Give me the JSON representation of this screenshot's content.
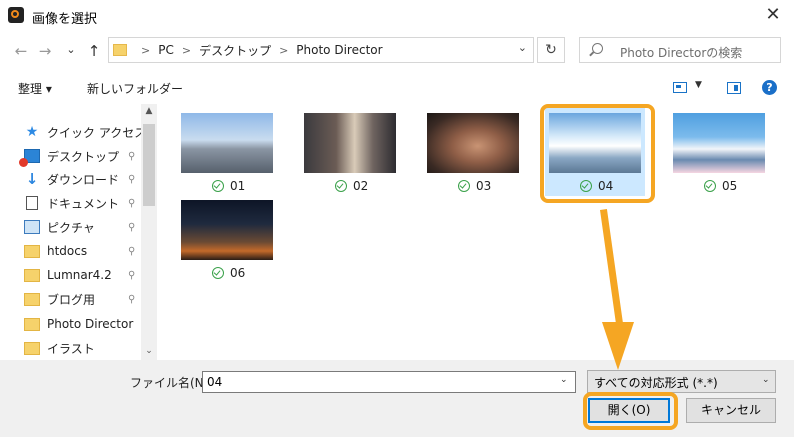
{
  "window": {
    "title": "画像を選択",
    "close_label": "✕"
  },
  "nav": {
    "back": "←",
    "forward": "→",
    "recent": "⌄",
    "up": "↑",
    "breadcrumb": [
      "PC",
      "デスクトップ",
      "Photo Director"
    ],
    "refresh": "↻",
    "search_placeholder": "Photo Directorの検索"
  },
  "toolbar": {
    "organize": "整理 ▾",
    "new_folder": "新しいフォルダー",
    "help": "?"
  },
  "sidebar": {
    "items": [
      {
        "label": "クイック アクセス",
        "icon": "star-icon",
        "pinned": false
      },
      {
        "label": "デスクトップ",
        "icon": "desktop-icon",
        "pinned": true
      },
      {
        "label": "ダウンロード",
        "icon": "download-icon",
        "pinned": true
      },
      {
        "label": "ドキュメント",
        "icon": "document-icon",
        "pinned": true
      },
      {
        "label": "ピクチャ",
        "icon": "pictures-icon",
        "pinned": true
      },
      {
        "label": "htdocs",
        "icon": "folder-icon",
        "pinned": true
      },
      {
        "label": "Lumnar4.2",
        "icon": "folder-icon",
        "pinned": true
      },
      {
        "label": "ブログ用",
        "icon": "folder-icon",
        "pinned": true
      },
      {
        "label": "Photo Director",
        "icon": "folder-icon",
        "pinned": false
      },
      {
        "label": "イラスト",
        "icon": "folder-icon",
        "pinned": false
      }
    ]
  },
  "files": [
    {
      "name": "01",
      "selected": false
    },
    {
      "name": "02",
      "selected": false
    },
    {
      "name": "03",
      "selected": false
    },
    {
      "name": "04",
      "selected": true
    },
    {
      "name": "05",
      "selected": false
    },
    {
      "name": "06",
      "selected": false
    }
  ],
  "footer": {
    "filename_label": "ファイル名(N):",
    "filename_value": "04",
    "filter_value": "すべての対応形式 (*.*)",
    "open_button": "開く(O)",
    "cancel_button": "キャンセル"
  },
  "colors": {
    "accent": "#0078d7",
    "highlight": "#f5a623",
    "selection": "#cce8ff"
  }
}
